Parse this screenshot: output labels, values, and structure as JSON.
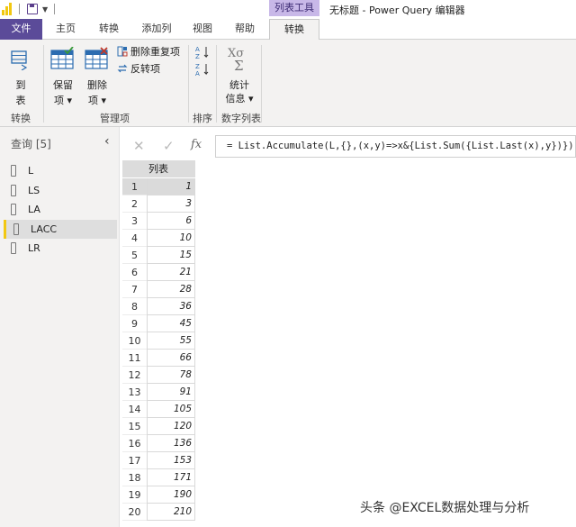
{
  "title_bar": {
    "context_group": "列表工具",
    "window_title": "无标题 - Power Query 编辑器"
  },
  "tabs": {
    "file": "文件",
    "home": "主页",
    "transform": "转换",
    "add_column": "添加列",
    "view": "视图",
    "help": "帮助",
    "context_transform": "转换"
  },
  "ribbon": {
    "to_table_line1": "到",
    "to_table_line2": "表",
    "keep_line1": "保留",
    "keep_line2": "项",
    "remove_line1": "删除",
    "remove_line2": "项",
    "remove_duplicates": "删除重复项",
    "reverse_items": "反转项",
    "stats_line1": "统计",
    "stats_line2": "信息",
    "group_convert": "转换",
    "group_manage": "管理项",
    "group_sort": "排序",
    "group_numeric": "数字列表"
  },
  "formula_bar": {
    "fx": "fx",
    "formula": "= List.Accumulate(L,{},(x,y)=>x&{List.Sum({List.Last(x),y})})"
  },
  "query_pane": {
    "title": "查询 [5]",
    "items": [
      {
        "label": "L"
      },
      {
        "label": "LS"
      },
      {
        "label": "LA"
      },
      {
        "label": "LACC"
      },
      {
        "label": "LR"
      }
    ],
    "active_index": 3
  },
  "grid": {
    "column_header": "列表",
    "selected_row": 0,
    "rows": [
      {
        "n": "1",
        "v": "1"
      },
      {
        "n": "2",
        "v": "3"
      },
      {
        "n": "3",
        "v": "6"
      },
      {
        "n": "4",
        "v": "10"
      },
      {
        "n": "5",
        "v": "15"
      },
      {
        "n": "6",
        "v": "21"
      },
      {
        "n": "7",
        "v": "28"
      },
      {
        "n": "8",
        "v": "36"
      },
      {
        "n": "9",
        "v": "45"
      },
      {
        "n": "10",
        "v": "55"
      },
      {
        "n": "11",
        "v": "66"
      },
      {
        "n": "12",
        "v": "78"
      },
      {
        "n": "13",
        "v": "91"
      },
      {
        "n": "14",
        "v": "105"
      },
      {
        "n": "15",
        "v": "120"
      },
      {
        "n": "16",
        "v": "136"
      },
      {
        "n": "17",
        "v": "153"
      },
      {
        "n": "18",
        "v": "171"
      },
      {
        "n": "19",
        "v": "190"
      },
      {
        "n": "20",
        "v": "210"
      }
    ]
  },
  "watermark": "头条 @EXCEL数据处理与分析"
}
